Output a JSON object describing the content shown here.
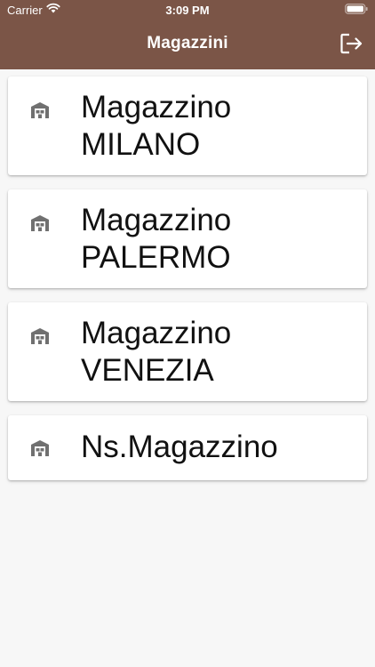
{
  "colors": {
    "header_bg": "#7b5547",
    "header_text": "#ffffff",
    "page_bg": "#f7f7f7",
    "card_bg": "#ffffff",
    "icon": "#707070",
    "text": "#111111"
  },
  "status_bar": {
    "carrier": "Carrier",
    "time": "3:09 PM"
  },
  "header": {
    "title": "Magazzini",
    "logout_icon": "logout-icon"
  },
  "warehouses": [
    {
      "line1": "Magazzino",
      "line2": "MILANO",
      "icon": "warehouse-icon"
    },
    {
      "line1": "Magazzino",
      "line2": "PALERMO",
      "icon": "warehouse-icon"
    },
    {
      "line1": "Magazzino",
      "line2": "VENEZIA",
      "icon": "warehouse-icon"
    },
    {
      "line1": "Ns.Magazzino",
      "icon": "warehouse-icon"
    }
  ]
}
